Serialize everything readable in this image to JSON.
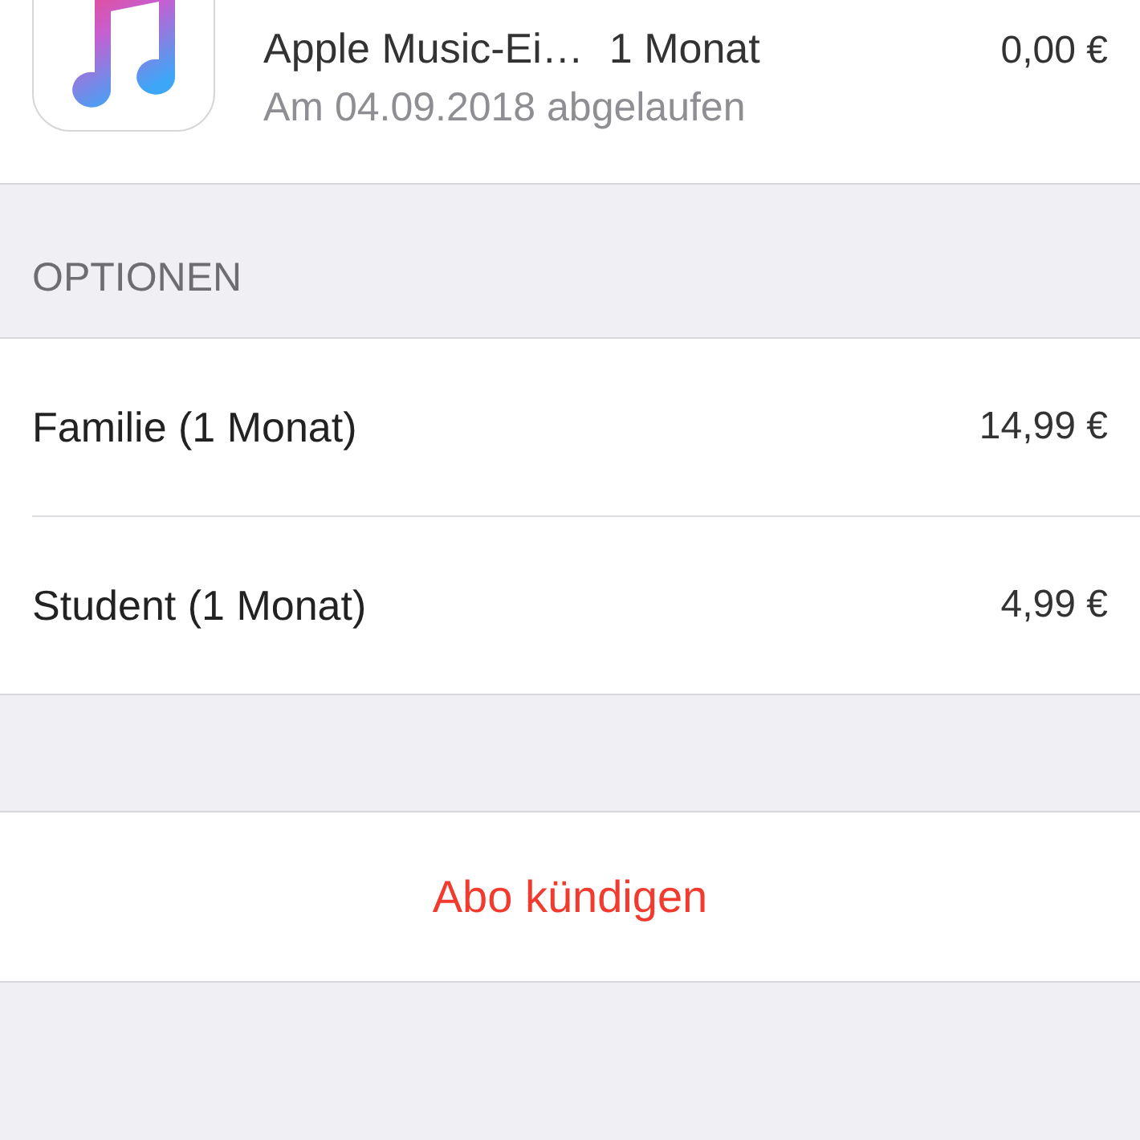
{
  "subscription": {
    "plan": "Apple Music-Ei…",
    "period": "1 Monat",
    "status": "Am 04.09.2018 abgelaufen",
    "price": "0,00 €"
  },
  "options": {
    "header": "OPTIONEN",
    "items": [
      {
        "label": "Familie (1 Monat)",
        "price": "14,99 €"
      },
      {
        "label": "Student (1 Monat)",
        "price": "4,99 €"
      }
    ]
  },
  "cancel_button": "Abo kündigen"
}
